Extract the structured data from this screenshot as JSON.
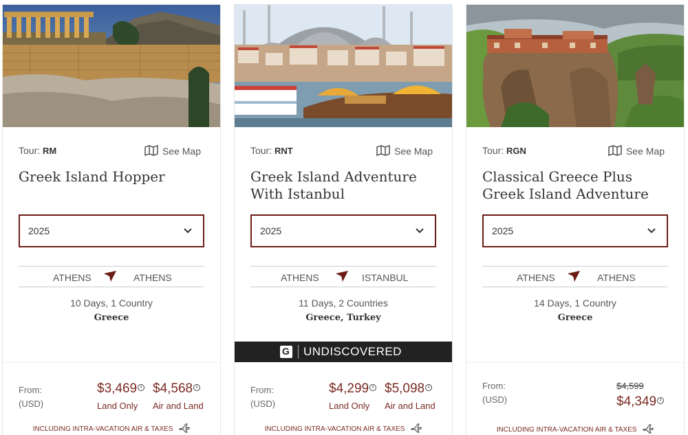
{
  "brand_color": "#6b1c16",
  "price_color": "#7a2a22",
  "cards": [
    {
      "tour_prefix": "Tour:",
      "tour_code": "RM",
      "see_map": "See Map",
      "title": "Greek Island Hopper",
      "year": "2025",
      "route_from": "ATHENS",
      "route_to": "ATHENS",
      "duration": "10 Days, 1 Country",
      "countries": "Greece",
      "from_label": "From:",
      "currency": "(USD)",
      "land_price": "$3,469",
      "land_label": "Land Only",
      "air_price": "$4,568",
      "air_label": "Air and Land",
      "including": "INCLUDING INTRA-VACATION AIR & TAXES",
      "image": "acropolis-photo"
    },
    {
      "tour_prefix": "Tour:",
      "tour_code": "RNT",
      "see_map": "See Map",
      "title": "Greek Island Adventure With Istanbul",
      "year": "2025",
      "route_from": "ATHENS",
      "route_to": "ISTANBUL",
      "duration": "11 Days, 2 Countries",
      "countries": "Greece, Turkey",
      "banner": "UNDISCOVERED",
      "from_label": "From:",
      "currency": "(USD)",
      "land_price": "$4,299",
      "land_label": "Land Only",
      "air_price": "$5,098",
      "air_label": "Air and Land",
      "including": "INCLUDING INTRA-VACATION AIR & TAXES",
      "image": "istanbul-mosque-photo"
    },
    {
      "tour_prefix": "Tour:",
      "tour_code": "RGN",
      "see_map": "See Map",
      "title": "Classical Greece Plus Greek Island Adventure",
      "year": "2025",
      "route_from": "ATHENS",
      "route_to": "ATHENS",
      "duration": "14 Days, 1 Country",
      "countries": "Greece",
      "from_label": "From:",
      "currency": "(USD)",
      "old_price": "$4,599",
      "price": "$4,349",
      "including": "INCLUDING INTRA-VACATION AIR & TAXES",
      "image": "meteora-monastery-photo"
    }
  ]
}
